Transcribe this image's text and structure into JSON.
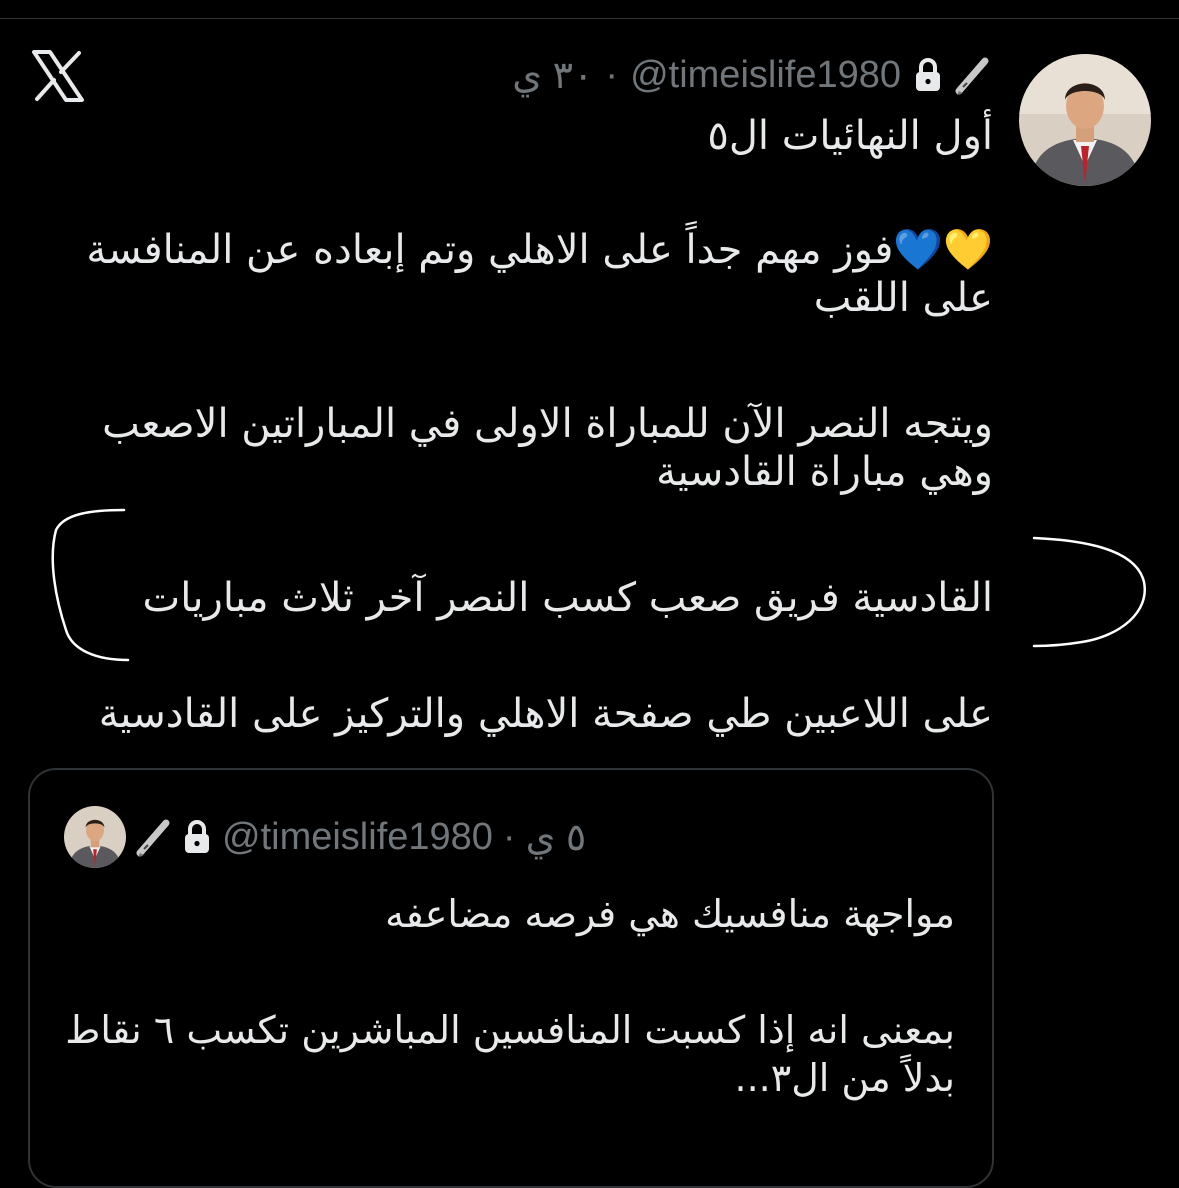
{
  "tweet": {
    "handle": "@timeislife1980",
    "separator": "·",
    "time": "٣٠ ي",
    "text": {
      "line1": "أول النهائيات  ال٥",
      "line2": "💛💙فوز مهم جداً على الاهلي وتم إبعاده عن المنافسة على اللقب",
      "line3": "ويتجه النصر الآن للمباراة الاولى في المباراتين الاصعب وهي مباراة القادسية",
      "line4": "القادسية فريق صعب كسب النصر آخر ثلاث مباريات",
      "line5": "على اللاعبين طي صفحة الاهلي والتركيز على القادسية"
    }
  },
  "quoted_tweet": {
    "handle": "@timeislife1980",
    "separator": "·",
    "time": "٥ ي",
    "text": {
      "line1": "مواجهة منافسيك هي فرصه مضاعفه",
      "line2": "بمعنى انه إذا كسبت المنافسين المباشرين تكسب ٦ نقاط بدلاً من ال٣..."
    }
  },
  "icons": {
    "app_logo": "x-logo-icon",
    "lock": "lock-icon",
    "pen": "fountain-pen-icon"
  },
  "colors": {
    "background": "#000000",
    "text": "#e7e9ea",
    "muted": "#71767b",
    "border": "#2f3336"
  }
}
